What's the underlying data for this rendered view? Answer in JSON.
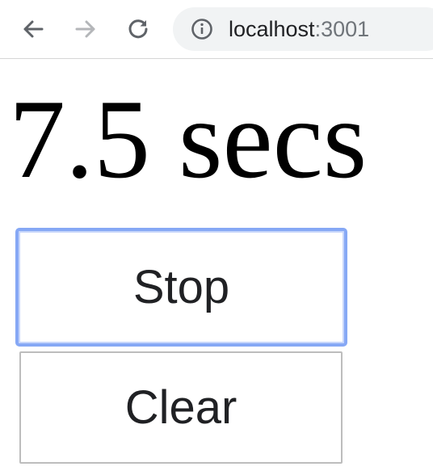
{
  "browser": {
    "url_host": "localhost",
    "url_port": ":3001",
    "icons": {
      "back": "arrow-left-icon",
      "forward": "arrow-right-icon",
      "reload": "reload-icon",
      "info": "info-icon"
    },
    "colors": {
      "omnibox_bg": "#f1f3f4",
      "icon_active": "#5f6368",
      "icon_disabled": "#b4b6b9"
    }
  },
  "timer": {
    "display": "7.5 secs"
  },
  "buttons": {
    "stop_label": "Stop",
    "clear_label": "Clear",
    "focus_color": "#86a8f5"
  }
}
